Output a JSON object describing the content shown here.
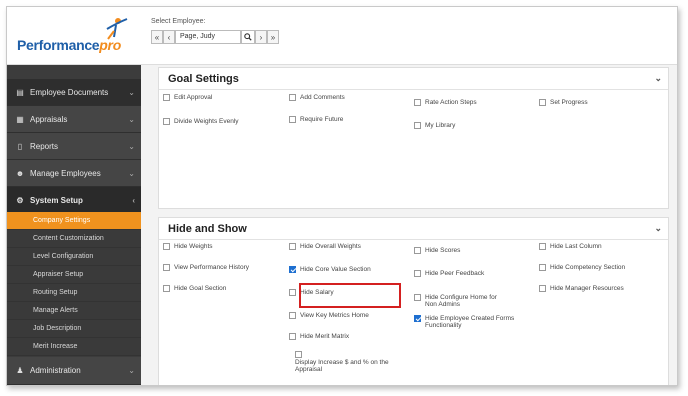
{
  "logo": {
    "brand": "Performance",
    "brand_suffix": "pro"
  },
  "header": {
    "employee_label": "Select Employee:",
    "employee_value": "Page, Judy",
    "first_label": "«",
    "prev_label": "‹",
    "next_label": "›",
    "last_label": "»"
  },
  "sidebar": {
    "main_items": [
      {
        "label": "Employee Documents",
        "icon": "document-icon"
      },
      {
        "label": "Appraisals",
        "icon": "appraisal-icon"
      },
      {
        "label": "Reports",
        "icon": "report-icon"
      },
      {
        "label": "Manage Employees",
        "icon": "people-icon"
      },
      {
        "label": "System Setup",
        "icon": "gear-icon"
      }
    ],
    "sub_items": [
      "Company Settings",
      "Content Customization",
      "Level Configuration",
      "Appraiser Setup",
      "Routing Setup",
      "Manage Alerts",
      "Job Description",
      "Merit Increase"
    ],
    "active_sub": "Company Settings",
    "bottom_item": {
      "label": "Administration",
      "icon": "user-icon"
    }
  },
  "goal_settings": {
    "title": "Goal Settings",
    "options": [
      {
        "label": "Edit Approval",
        "checked": false
      },
      {
        "label": "Add Comments",
        "checked": false
      },
      {
        "label": "Rate Action Steps",
        "checked": false
      },
      {
        "label": "Set Progress",
        "checked": false
      },
      {
        "label": "Divide Weights Evenly",
        "checked": false
      },
      {
        "label": "Require Future",
        "checked": false
      },
      {
        "label": "My Library",
        "checked": false
      }
    ]
  },
  "hide_and_show": {
    "title": "Hide and Show",
    "options": [
      {
        "label": "Hide Weights",
        "checked": false
      },
      {
        "label": "Hide Overall Weights",
        "checked": false
      },
      {
        "label": "Hide Scores",
        "checked": false
      },
      {
        "label": "Hide Last Column",
        "checked": false
      },
      {
        "label": "View Performance History",
        "checked": false
      },
      {
        "label": "Hide Core Value Section",
        "checked": true
      },
      {
        "label": "Hide Peer Feedback",
        "checked": false
      },
      {
        "label": "Hide Competency Section",
        "checked": false
      },
      {
        "label": "Hide Goal Section",
        "checked": false
      },
      {
        "label": "Hide Salary",
        "checked": false
      },
      {
        "label": "Hide Configure Home for Non Admins",
        "checked": false
      },
      {
        "label": "Hide Manager Resources",
        "checked": false
      },
      {
        "label": "View Key Metrics Home",
        "checked": false
      },
      {
        "label": "Hide Employee Created Forms Functionality",
        "checked": true
      },
      {
        "label": "Hide Merit Matrix",
        "checked": false
      },
      {
        "label": "Display Increase $ and % on the Appraisal",
        "checked": false
      }
    ]
  },
  "colors": {
    "accent": "#f0921e",
    "brand_blue": "#1f5fa8",
    "highlight": "#d42020",
    "checkbox_checked": "#1e6fd0"
  }
}
